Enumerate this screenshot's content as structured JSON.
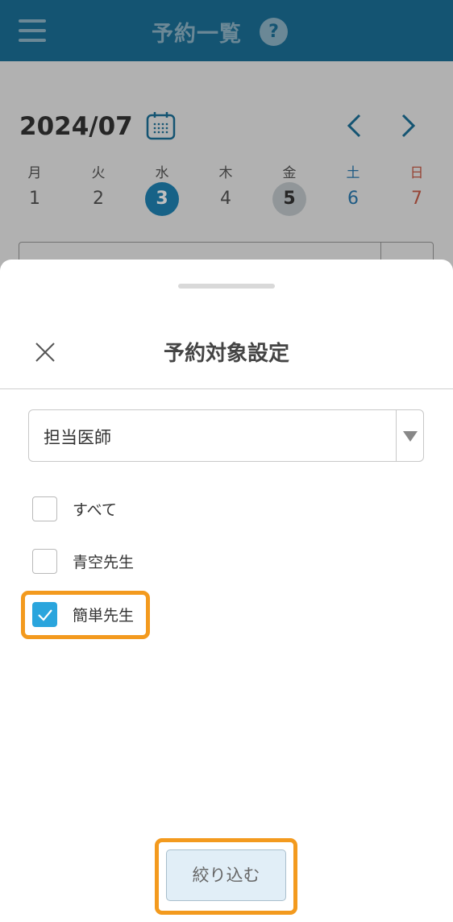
{
  "header": {
    "title": "予約一覧",
    "help": "?"
  },
  "calendar": {
    "month": "2024/07",
    "days": [
      {
        "weekday": "月",
        "date": "1"
      },
      {
        "weekday": "火",
        "date": "2"
      },
      {
        "weekday": "水",
        "date": "3"
      },
      {
        "weekday": "木",
        "date": "4"
      },
      {
        "weekday": "金",
        "date": "5"
      },
      {
        "weekday": "土",
        "date": "6"
      },
      {
        "weekday": "日",
        "date": "7"
      }
    ]
  },
  "sheet": {
    "title": "予約対象設定",
    "filter_select": {
      "value": "担当医師"
    },
    "options": [
      {
        "label": "すべて",
        "checked": false
      },
      {
        "label": "青空先生",
        "checked": false
      },
      {
        "label": "簡単先生",
        "checked": true
      }
    ],
    "apply_label": "絞り込む"
  },
  "colors": {
    "header": "#1b7099",
    "today": "#1f83b5",
    "checkbox_checked": "#2aa5dd",
    "highlight": "#f39a1e",
    "saturday": "#2a7ab0",
    "sunday": "#c85d48"
  }
}
